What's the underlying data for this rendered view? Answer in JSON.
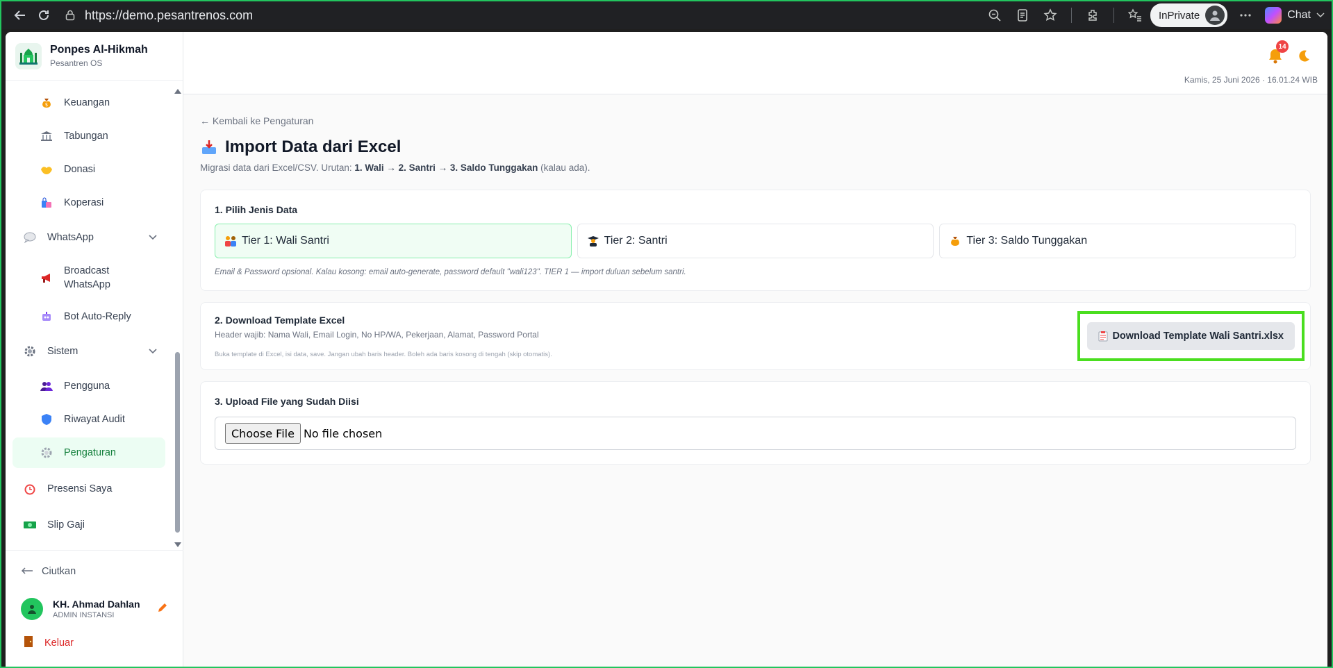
{
  "browser": {
    "url": "https://demo.pesantrenos.com",
    "inprivate_label": "InPrivate",
    "chat_label": "Chat"
  },
  "brand": {
    "title": "Ponpes Al-Hikmah",
    "subtitle": "Pesantren OS"
  },
  "sidebar": {
    "items": [
      {
        "label": "Keuangan",
        "icon": "money-bag-icon"
      },
      {
        "label": "Tabungan",
        "icon": "bank-icon"
      },
      {
        "label": "Donasi",
        "icon": "hands-icon"
      },
      {
        "label": "Koperasi",
        "icon": "shopping-bags-icon"
      },
      {
        "label": "WhatsApp",
        "icon": "speech-bubble-icon"
      },
      {
        "label": "Broadcast WhatsApp",
        "icon": "megaphone-icon"
      },
      {
        "label": "Bot Auto-Reply",
        "icon": "robot-icon"
      },
      {
        "label": "Sistem",
        "icon": "gear-icon"
      },
      {
        "label": "Pengguna",
        "icon": "users-icon"
      },
      {
        "label": "Riwayat Audit",
        "icon": "shield-icon"
      },
      {
        "label": "Pengaturan",
        "icon": "gear-icon"
      },
      {
        "label": "Presensi Saya",
        "icon": "alarm-clock-icon"
      },
      {
        "label": "Slip Gaji",
        "icon": "banknote-icon"
      }
    ],
    "collapse_label": "Ciutkan",
    "user": {
      "name": "KH. Ahmad Dahlan",
      "role": "ADMIN INSTANSI"
    },
    "logout_label": "Keluar"
  },
  "topbar": {
    "notification_count": "14",
    "datetime": "Kamis, 25 Juni 2026 · 16.01.24 WIB"
  },
  "page": {
    "back_link": "← Kembali ke Pengaturan",
    "title": "Import Data dari Excel",
    "subtitle_prefix": "Migrasi data dari Excel/CSV. Urutan: ",
    "subtitle_order": "1. Wali → 2. Santri → 3. Saldo Tunggakan",
    "subtitle_suffix": " (kalau ada)."
  },
  "step1": {
    "heading": "1. Pilih Jenis Data",
    "tiers": [
      {
        "label": "Tier 1: Wali Santri",
        "icon": "family-icon",
        "selected": true
      },
      {
        "label": "Tier 2: Santri",
        "icon": "student-icon",
        "selected": false
      },
      {
        "label": "Tier 3: Saldo Tunggakan",
        "icon": "money-bag-icon",
        "selected": false
      }
    ],
    "note": "Email & Password opsional. Kalau kosong: email auto-generate, password default \"wali123\". TIER 1 — import duluan sebelum santri."
  },
  "step2": {
    "heading": "2. Download Template Excel",
    "headers_text": "Header wajib: Nama Wali, Email Login, No HP/WA, Pekerjaan, Alamat, Password Portal",
    "hint": "Buka template di Excel, isi data, save. Jangan ubah baris header. Boleh ada baris kosong di tengah (skip otomatis).",
    "button_label": "Download Template Wali Santri.xlsx"
  },
  "step3": {
    "heading": "3. Upload File yang Sudah Diisi",
    "choose_label": "Choose File",
    "file_status": "No file chosen"
  },
  "colors": {
    "accent": "#15803d",
    "highlight": "#4ade1f",
    "danger": "#dc2626"
  }
}
